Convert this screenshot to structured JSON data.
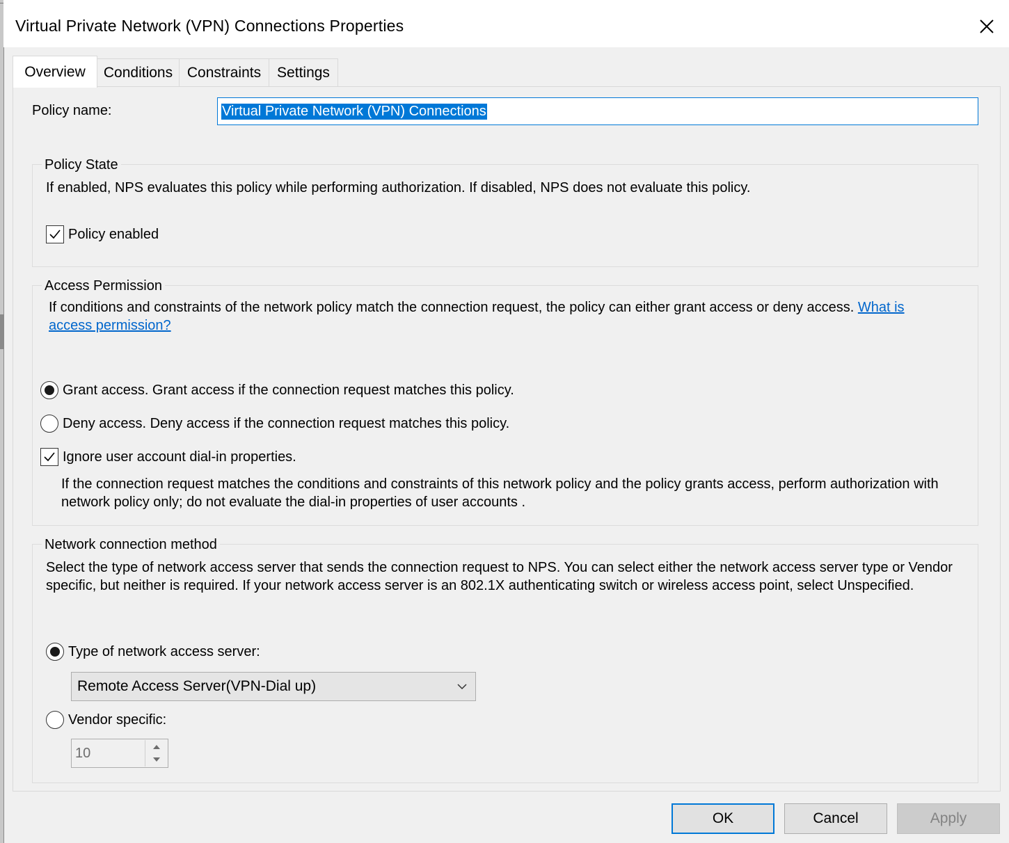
{
  "window": {
    "title": "Virtual Private Network (VPN) Connections Properties",
    "close_icon": "close-icon"
  },
  "tabs": [
    {
      "label": "Overview",
      "active": true
    },
    {
      "label": "Conditions",
      "active": false
    },
    {
      "label": "Constraints",
      "active": false
    },
    {
      "label": "Settings",
      "active": false
    }
  ],
  "policy_name": {
    "label": "Policy name:",
    "value": "Virtual Private Network (VPN) Connections"
  },
  "policy_state": {
    "title": "Policy State",
    "description": "If enabled, NPS evaluates this policy while performing authorization. If disabled, NPS does not evaluate this policy.",
    "enabled_label": "Policy enabled",
    "enabled": true
  },
  "access_permission": {
    "title": "Access Permission",
    "description": "If conditions and constraints of the network policy match the connection request, the policy can either grant access or deny access.",
    "link": "What is access permission?",
    "grant_label": "Grant access. Grant access if the connection request matches this policy.",
    "deny_label": "Deny access. Deny access if the connection request matches this policy.",
    "selected": "grant",
    "ignore_label": "Ignore user account dial-in properties.",
    "ignore_checked": true,
    "ignore_description": "If the connection request matches the conditions and constraints of this network policy and the policy grants access, perform authorization with network policy only; do not evaluate the dial-in properties of user accounts ."
  },
  "network_method": {
    "title": "Network connection method",
    "description": "Select the type of network access server that sends the connection request to NPS. You can select either the network access server type or Vendor specific, but neither is required.  If your network access server is an 802.1X authenticating switch or wireless access point, select Unspecified.",
    "type_label": "Type of network access server:",
    "type_value": "Remote Access Server(VPN-Dial up)",
    "vendor_label": "Vendor specific:",
    "vendor_value": "10",
    "selected": "type"
  },
  "buttons": {
    "ok": "OK",
    "cancel": "Cancel",
    "apply": "Apply"
  },
  "colors": {
    "accent": "#0078d7",
    "link": "#0066cc",
    "panel": "#f0f0f0"
  }
}
